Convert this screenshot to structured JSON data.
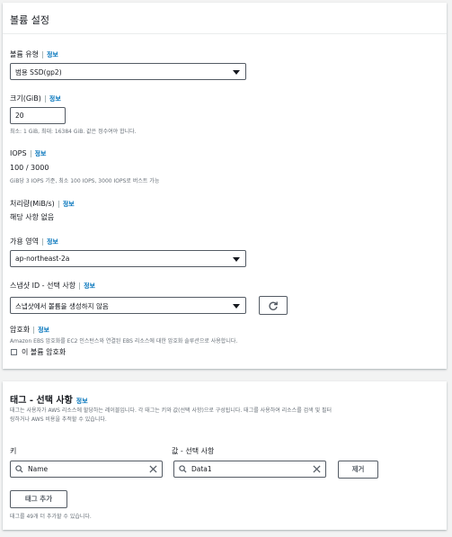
{
  "volume_panel": {
    "title": "볼륨 설정",
    "info_link": "정보",
    "volume_type": {
      "label": "볼륨 유형",
      "value": "범용 SSD(gp2)"
    },
    "size": {
      "label": "크기(GiB)",
      "value": "20",
      "hint": "최소: 1 GiB, 최대: 16384 GiB. 값은 정수여야 합니다."
    },
    "iops": {
      "label": "IOPS",
      "value": "100 / 3000",
      "hint": "GiB당 3 IOPS 기준, 최소 100 IOPS, 3000 IOPS로 버스트 가능"
    },
    "throughput": {
      "label": "처리량(MiB/s)",
      "value": "해당 사항 없음"
    },
    "az": {
      "label": "가용 영역",
      "value": "ap-northeast-2a"
    },
    "snapshot": {
      "label": "스냅샷 ID - 선택 사항",
      "value": "스냅샷에서 볼륨을 생성하지 않음"
    },
    "encryption": {
      "label": "암호화",
      "hint": "Amazon EBS 암호화를 EC2 인스턴스와 연결된 EBS 리소스에 대한 암호화 솔루션으로 사용합니다.",
      "checkbox_label": "이 볼륨 암호화"
    }
  },
  "tags_panel": {
    "title": "태그 - 선택 사항",
    "info_link": "정보",
    "description": "태그는 사용자가 AWS 리소스에 할당하는 레이블입니다. 각 태그는 키와 값(선택 사항)으로 구성됩니다. 태그를 사용하여 리소스를 검색 및 필터링하거나 AWS 비용을 추적할 수 있습니다.",
    "description_line1": "태그는 사용자가 AWS 리소스에 할당하는 레이블입니다. 각 태그는 키와 값(선택 사항)으로 구성됩니다. 태그를 사용하여 리소스를 검색 및 필터",
    "description_line2": "링하거나 AWS 비용을 추적할 수 있습니다.",
    "key_label": "키",
    "value_label": "값 - 선택 사항",
    "key_value": "Name",
    "value_value": "Data1",
    "remove_label": "제거",
    "add_label": "태그 추가",
    "remaining_hint": "태그를 49개 더 추가할 수 있습니다."
  }
}
